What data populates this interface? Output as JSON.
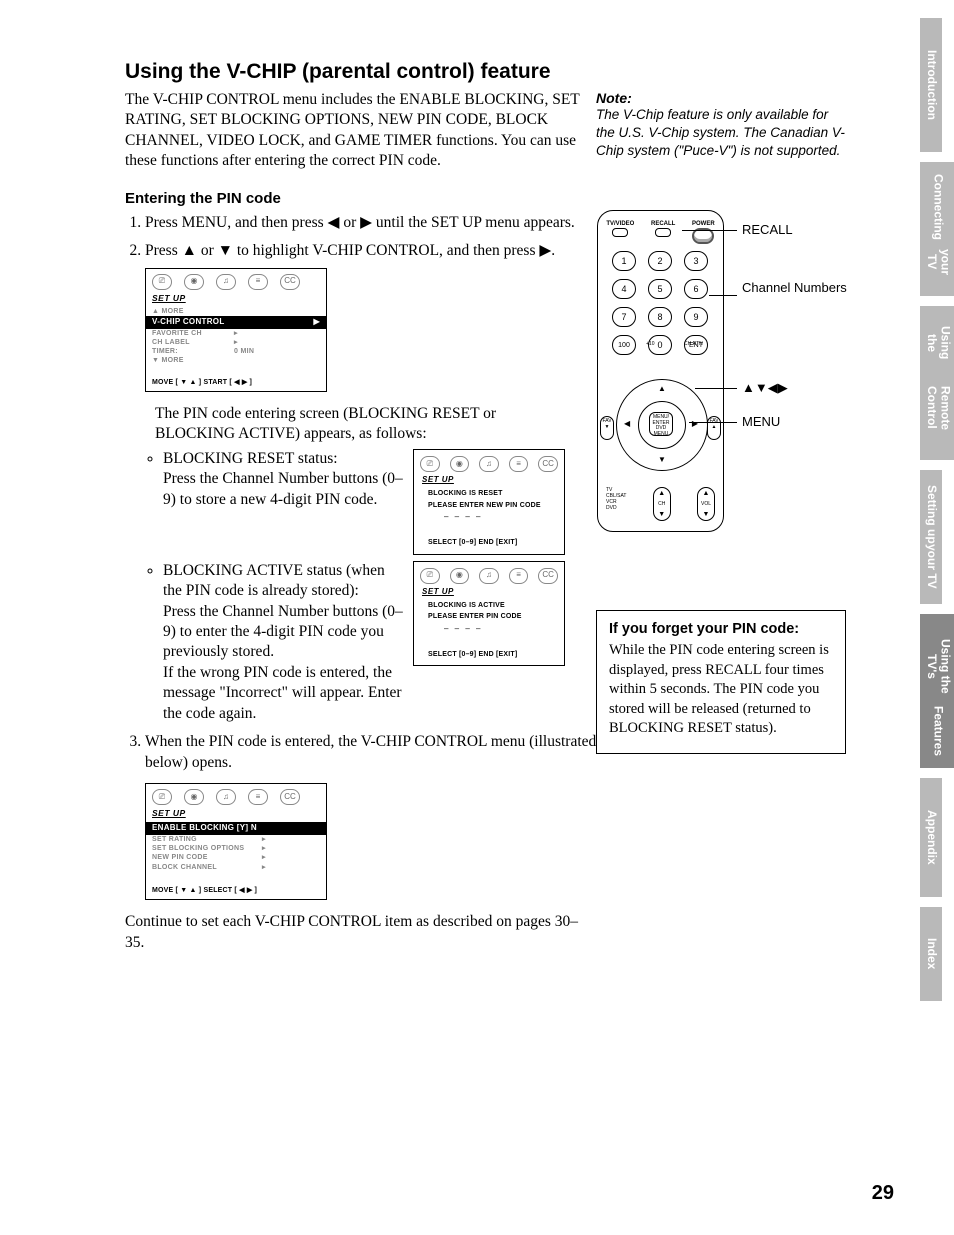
{
  "page_number": "29",
  "title": "Using the V-CHIP (parental control) feature",
  "intro": "The V-CHIP CONTROL menu includes the ENABLE BLOCKING, SET RATING, SET BLOCKING OPTIONS, NEW PIN CODE, BLOCK CHANNEL, VIDEO LOCK, and GAME TIMER functions. You can use these functions after entering the correct PIN code.",
  "section": {
    "heading": "Entering the PIN code",
    "step1": "Press MENU, and then press ◀ or ▶ until the SET UP menu appears.",
    "step2": "Press ▲ or ▼ to highlight V-CHIP CONTROL, and then press ▶.",
    "step2_post": "The PIN code entering screen (BLOCKING RESET or BLOCKING ACTIVE) appears, as follows:",
    "bullet_reset_title": "BLOCKING RESET status:",
    "bullet_reset_body": "Press the Channel Number buttons (0–9) to store a new 4-digit PIN code.",
    "bullet_active_title": "BLOCKING ACTIVE status (when the PIN code is already stored):",
    "bullet_active_body1": "Press the Channel Number buttons (0–9) to enter the 4-digit PIN code you previously stored.",
    "bullet_active_body2": "If the wrong PIN code is entered, the message \"Incorrect\" will appear. Enter the code again.",
    "step3": "When the PIN code is entered, the V-CHIP CONTROL menu (illustrated below) opens.",
    "continue": "Continue to set each V-CHIP CONTROL item as described on pages 30–35."
  },
  "note": {
    "head": "Note:",
    "body": "The V-Chip feature is only available for the U.S. V-Chip system. The Canadian V-Chip system (\"Puce-V\") is not supported."
  },
  "menu1": {
    "title": "SET UP",
    "more_up": "▲ MORE",
    "highlight": "V-CHIP CONTROL",
    "row1": "FAVORITE CH",
    "row2": "CH LABEL",
    "row3_label": "TIMER:",
    "row3_val": "0 MIN",
    "more_down": "▼ MORE",
    "foot": "MOVE [ ▼ ▲ ]     START [ ◀  ▶ ]"
  },
  "screen_reset": {
    "title": "SET UP",
    "msg1": "BLOCKING IS RESET",
    "msg2": "PLEASE ENTER NEW PIN CODE",
    "dash": "– – – –",
    "foot": "SELECT [0–9]    END [EXIT]"
  },
  "screen_active": {
    "title": "SET UP",
    "msg1": "BLOCKING IS ACTIVE",
    "msg2": "PLEASE ENTER PIN CODE",
    "dash": "– – – –",
    "foot": "SELECT [0–9]    END [EXIT]"
  },
  "menu3": {
    "title": "SET UP",
    "highlight": "ENABLE BLOCKING   [Y]  N",
    "row1": "SET RATING",
    "row2": "SET BLOCKING OPTIONS",
    "row3": "NEW PIN CODE",
    "row4": "BLOCK CHANNEL",
    "foot": "MOVE [ ▼ ▲ ]     SELECT [ ◀  ▶ ]"
  },
  "remote": {
    "top1": "TV/VIDEO",
    "top2": "RECALL",
    "top3": "POWER",
    "buttons": [
      "1",
      "2",
      "3",
      "4",
      "5",
      "6",
      "7",
      "8",
      "9",
      "100",
      "0",
      "ENT"
    ],
    "plus10": "+10",
    "chrtn": "CH RTN",
    "center": "MENU/\nENTER\nDVD MENU",
    "fav": "FAV",
    "mode": "TV\nCBL/SAT\nVCR\nDVD",
    "ch": "CH",
    "vol": "VOL",
    "label_recall": "RECALL",
    "label_channel": "Channel Numbers",
    "label_arrows": "▲▼◀▶",
    "label_menu": "MENU"
  },
  "forget": {
    "heading": "If you forget your PIN code:",
    "body": "While the PIN code entering screen is displayed, press RECALL four times within 5 seconds. The PIN code you stored will be released (returned to BLOCKING RESET status)."
  },
  "tabs": {
    "t1": "Introduction",
    "t2a": "Connecting",
    "t2b": "your TV",
    "t3a": "Using the",
    "t3b": "Remote Control",
    "t4a": "Setting up",
    "t4b": "your TV",
    "t5a": "Using the TV's",
    "t5b": "Features",
    "t6": "Appendix",
    "t7": "Index"
  },
  "icons": {
    "i1": "⎚",
    "i2": "◉",
    "i3": "♫",
    "i4": "≡",
    "i5": "CC"
  }
}
